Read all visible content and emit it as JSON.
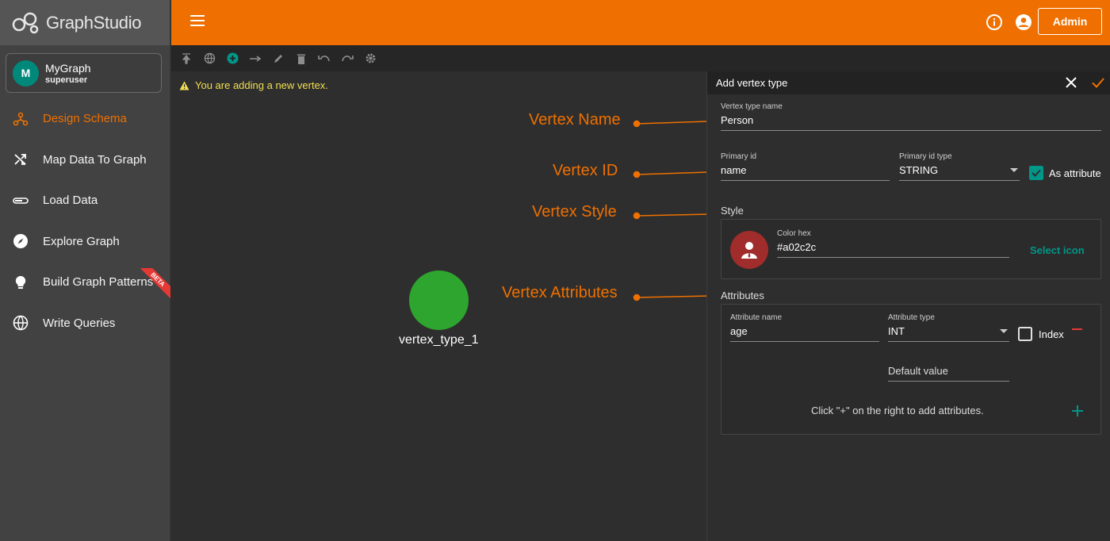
{
  "app": {
    "logo_text_bold": "Graph",
    "logo_text_rest": "Studio",
    "admin_label": "Admin",
    "info_icon": "info-icon",
    "account_icon": "account-icon"
  },
  "graph": {
    "avatar_letter": "M",
    "name": "MyGraph",
    "role": "superuser"
  },
  "nav": [
    {
      "label": "Design Schema",
      "icon": "schema-icon",
      "active": true
    },
    {
      "label": "Map Data To Graph",
      "icon": "shuffle-icon"
    },
    {
      "label": "Load Data",
      "icon": "load-icon"
    },
    {
      "label": "Explore Graph",
      "icon": "compass-icon"
    },
    {
      "label": "Build Graph Patterns",
      "icon": "lightbulb-icon",
      "badge": "BETA"
    },
    {
      "label": "Write Queries",
      "icon": "globe-icon"
    }
  ],
  "toolbar_icons": [
    "upload-icon",
    "globe-icon",
    "add-circle-icon",
    "arrow-right-icon",
    "edit-icon",
    "delete-icon",
    "undo-icon",
    "redo-icon",
    "settings-icon"
  ],
  "canvas": {
    "warning": "You are adding a new vertex.",
    "vertex_label": "vertex_type_1",
    "vertex_color": "#2ea52e"
  },
  "annotations": {
    "vertex_name": "Vertex Name",
    "vertex_id": "Vertex ID",
    "vertex_style": "Vertex Style",
    "vertex_attributes": "Vertex Attributes"
  },
  "panel": {
    "title": "Add vertex type",
    "vertex_type_name_label": "Vertex type name",
    "vertex_type_name_value": "Person",
    "primary_id_label": "Primary id",
    "primary_id_value": "name",
    "primary_id_type_label": "Primary id type",
    "primary_id_type_value": "STRING",
    "as_attribute_label": "As attribute",
    "as_attribute_checked": true,
    "style_title": "Style",
    "color_hex_label": "Color hex",
    "color_hex_value": "#a02c2c",
    "select_icon_label": "Select icon",
    "attributes_title": "Attributes",
    "attribute_name_label": "Attribute name",
    "attribute_name_value": "age",
    "attribute_type_label": "Attribute type",
    "attribute_type_value": "INT",
    "index_label": "Index",
    "index_checked": false,
    "default_value_placeholder": "Default value",
    "add_hint": "Click \"+\" on the right to add attributes."
  },
  "colors": {
    "accent": "#ef7000",
    "teal": "#009688",
    "danger": "#e53935"
  }
}
